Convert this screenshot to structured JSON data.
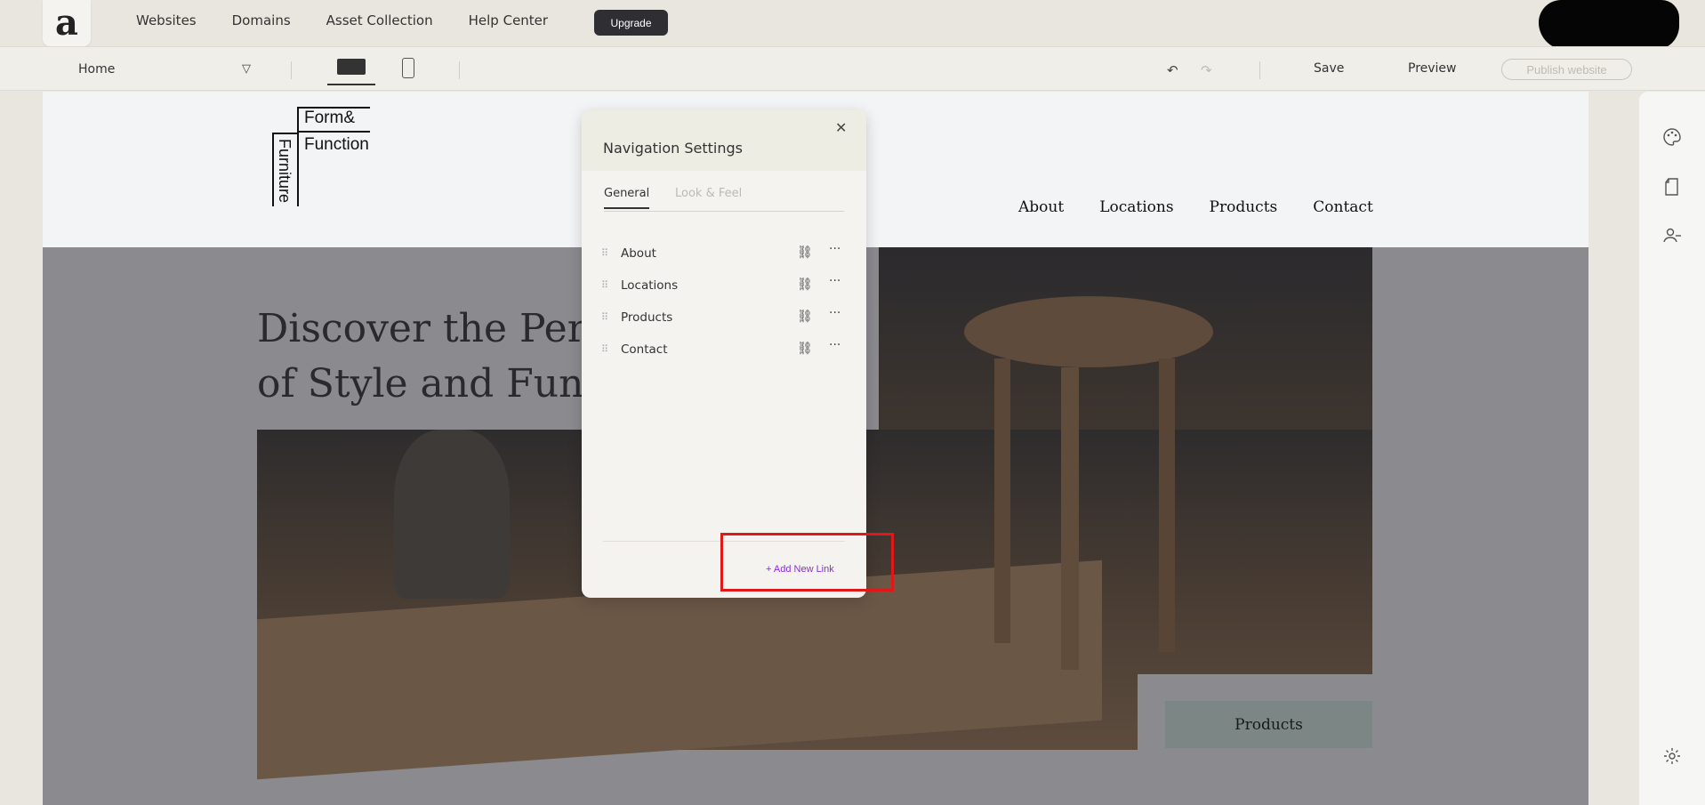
{
  "app": {
    "logo_letter": "a",
    "nav": [
      "Websites",
      "Domains",
      "Asset Collection",
      "Help Center"
    ],
    "upgrade_label": "Upgrade"
  },
  "toolbar": {
    "page_selected": "Home",
    "save_label": "Save",
    "preview_label": "Preview",
    "publish_label": "Publish website"
  },
  "site": {
    "logo": {
      "line1": "Form&",
      "line2": "Function",
      "vertical": "Furniture"
    },
    "nav": [
      "About",
      "Locations",
      "Products",
      "Contact"
    ],
    "hero_title_line1": "Discover the Per",
    "hero_title_line2": "of Style and Func",
    "products_button": "Products"
  },
  "modal": {
    "title": "Navigation Settings",
    "tabs": [
      "General",
      "Look & Feel"
    ],
    "active_tab": "General",
    "links": [
      "About",
      "Locations",
      "Products",
      "Contact"
    ],
    "add_link_label": "+ Add New Link"
  },
  "colors": {
    "accent_purple": "#8a2be2",
    "highlight_red": "#e01818",
    "upgrade_bg": "#2f2f33"
  },
  "icons": [
    "palette-icon",
    "page-icon",
    "users-icon",
    "settings-icon",
    "link-icon",
    "more-icon",
    "drag-handle-icon",
    "close-icon",
    "undo-icon",
    "redo-icon",
    "desktop-icon",
    "mobile-icon"
  ]
}
